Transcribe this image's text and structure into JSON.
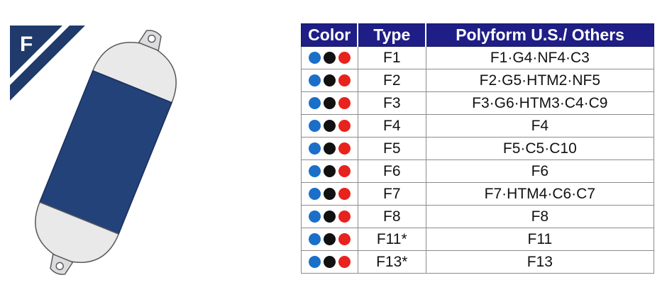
{
  "badge": {
    "letter": "F",
    "color": "#1f3a6b"
  },
  "fender": {
    "body_color": "#23427a",
    "cap_color": "#e9e9ea",
    "outline_color": "#5a5a5a"
  },
  "table": {
    "headers": {
      "color": "Color",
      "type": "Type",
      "others": "Polyform U.S./ Others"
    },
    "dot_colors": [
      "#1b6fc9",
      "#111111",
      "#e8231d"
    ],
    "rows": [
      {
        "type": "F1",
        "others": "F1·G4·NF4·C3"
      },
      {
        "type": "F2",
        "others": "F2·G5·HTM2·NF5"
      },
      {
        "type": "F3",
        "others": "F3·G6·HTM3·C4·C9"
      },
      {
        "type": "F4",
        "others": "F4"
      },
      {
        "type": "F5",
        "others": "F5·C5·C10"
      },
      {
        "type": "F6",
        "others": "F6"
      },
      {
        "type": "F7",
        "others": "F7·HTM4·C6·C7"
      },
      {
        "type": "F8",
        "others": "F8"
      },
      {
        "type": "F11*",
        "others": "F11"
      },
      {
        "type": "F13*",
        "others": "F13"
      }
    ]
  }
}
